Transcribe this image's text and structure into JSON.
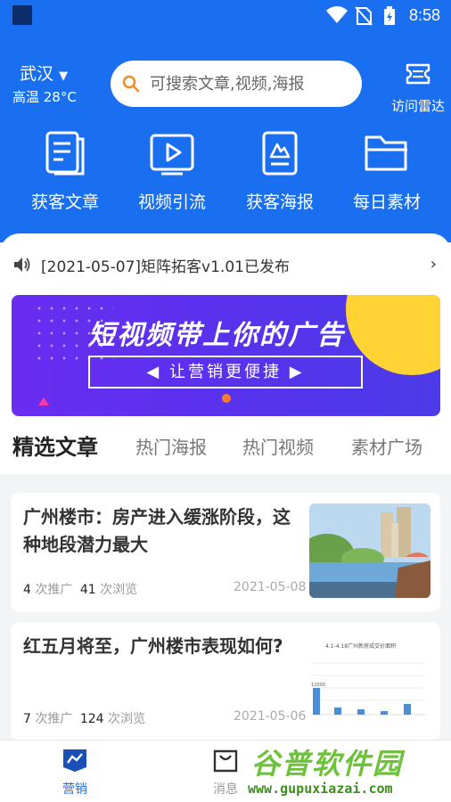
{
  "status_bar": {
    "time": "8:58"
  },
  "header": {
    "city": "武汉",
    "weather": "高温 28°C",
    "search_placeholder": "可搜索文章,视频,海报",
    "radar_label": "访问雷达"
  },
  "shortcuts": [
    {
      "label": "获客文章",
      "icon": "article-icon"
    },
    {
      "label": "视频引流",
      "icon": "video-icon"
    },
    {
      "label": "获客海报",
      "icon": "poster-icon"
    },
    {
      "label": "每日素材",
      "icon": "folder-icon"
    }
  ],
  "notice": {
    "text": "[2021-05-07]矩阵拓客v1.01已发布"
  },
  "banner": {
    "title": "短视频带上你的广告",
    "subtitle": "◀ 让营销更便捷 ▶"
  },
  "tabs": [
    {
      "label": "精选文章",
      "active": true
    },
    {
      "label": "热门海报",
      "active": false
    },
    {
      "label": "热门视频",
      "active": false
    },
    {
      "label": "素材广场",
      "active": false
    }
  ],
  "articles": [
    {
      "title": "广州楼市：房产进入缓涨阶段，这种地段潜力最大",
      "shares": "4",
      "shares_label": "次推广",
      "views": "41",
      "views_label": "次浏览",
      "date": "2021-05-08"
    },
    {
      "title": "红五月将至，广州楼市表现如何?",
      "shares": "7",
      "shares_label": "次推广",
      "views": "124",
      "views_label": "次浏览",
      "date": "2021-05-06",
      "thumb_caption": "4.1-4.18广州新房成交价面积",
      "thumb_value": "12000"
    }
  ],
  "bottom_nav": [
    {
      "label": "营销",
      "active": true
    },
    {
      "label": "消息",
      "active": false
    }
  ],
  "watermark": {
    "name": "谷普软件园",
    "url": "www.gupuxiazai.com"
  },
  "colors": {
    "primary": "#1a6ff0",
    "banner": "#5a31ee",
    "sun": "#ffd333"
  }
}
